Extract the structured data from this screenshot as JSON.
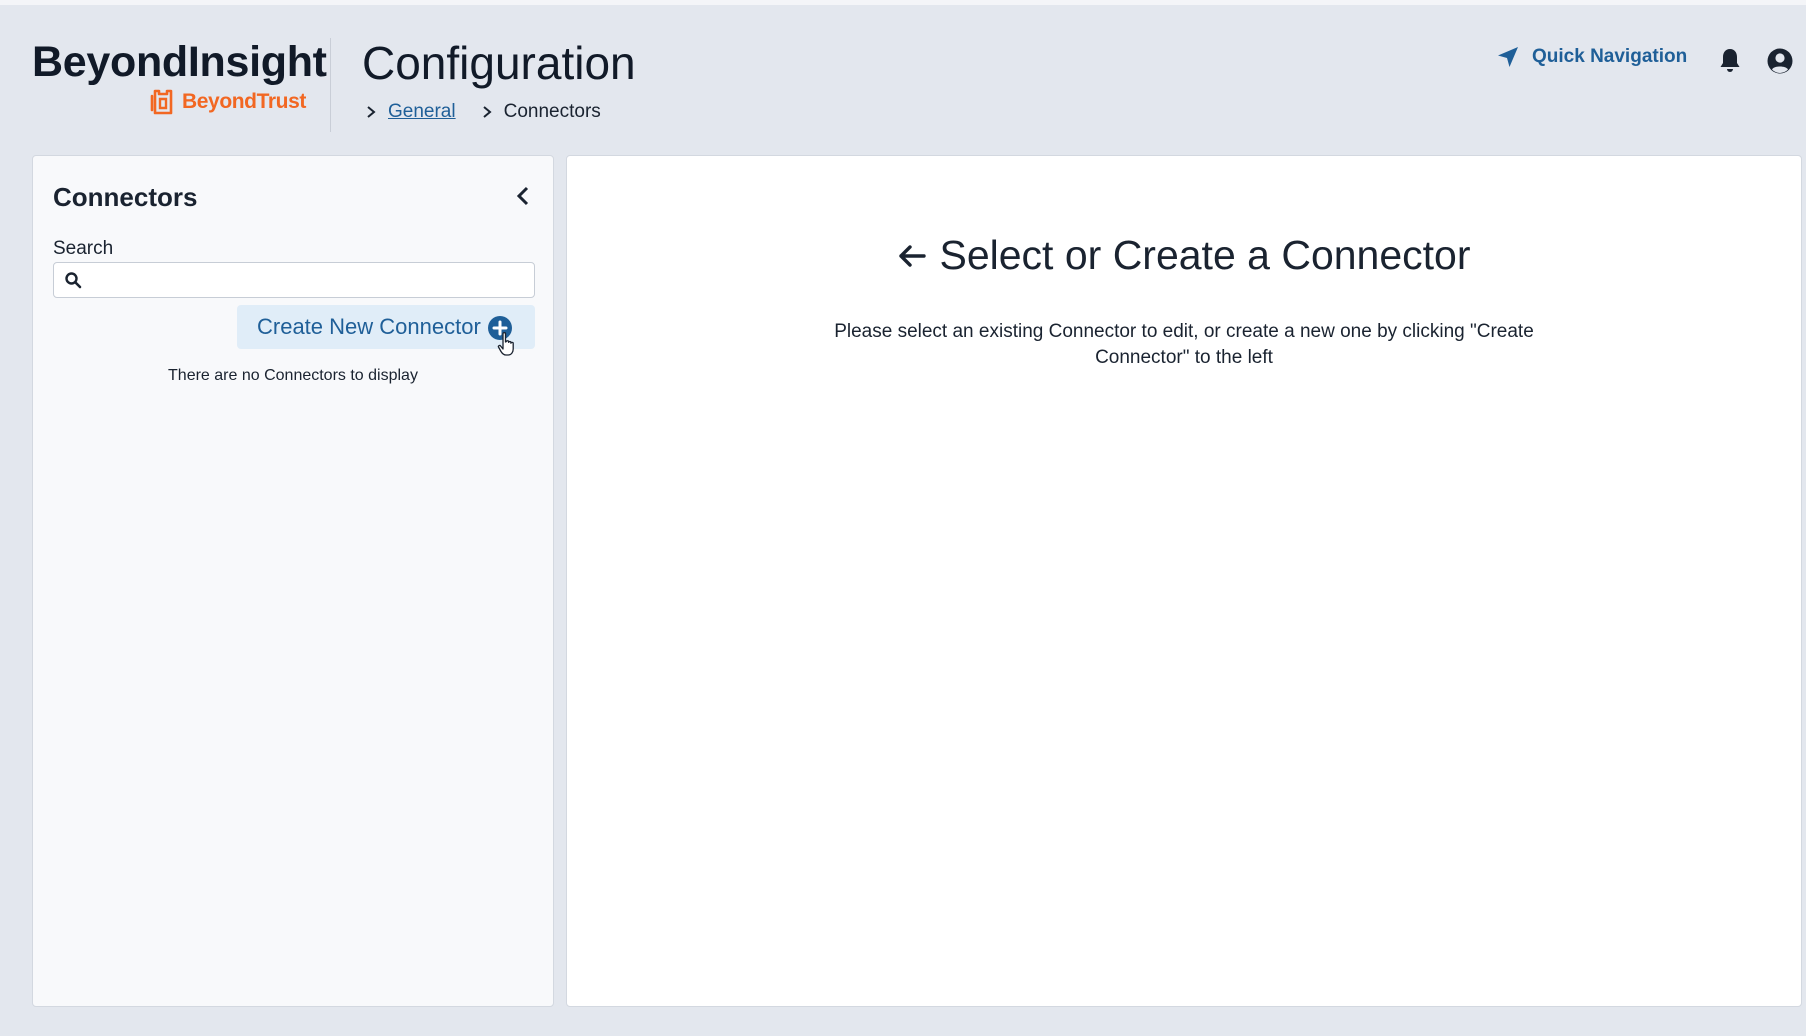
{
  "header": {
    "brand_title": "BeyondInsight",
    "brand_sub": "BeyondTrust",
    "page_title": "Configuration",
    "breadcrumb": [
      "General",
      "Connectors"
    ],
    "quick_nav_label": "Quick Navigation",
    "icons": [
      "location-arrow-icon",
      "bell-icon",
      "user-circle-icon"
    ]
  },
  "sidebar": {
    "title": "Connectors",
    "search_label": "Search",
    "search_value": "",
    "create_button_label": "Create New Connector",
    "empty_message": "There are no Connectors to display"
  },
  "main": {
    "heading": "Select or Create a Connector",
    "description": "Please select an existing Connector to edit, or create a new one by clicking \"Create Connector\" to the left"
  },
  "colors": {
    "background": "#e3e7ee",
    "accent_blue": "#1f5f98",
    "brand_orange": "#f26722",
    "button_bg": "#e0edf8"
  }
}
